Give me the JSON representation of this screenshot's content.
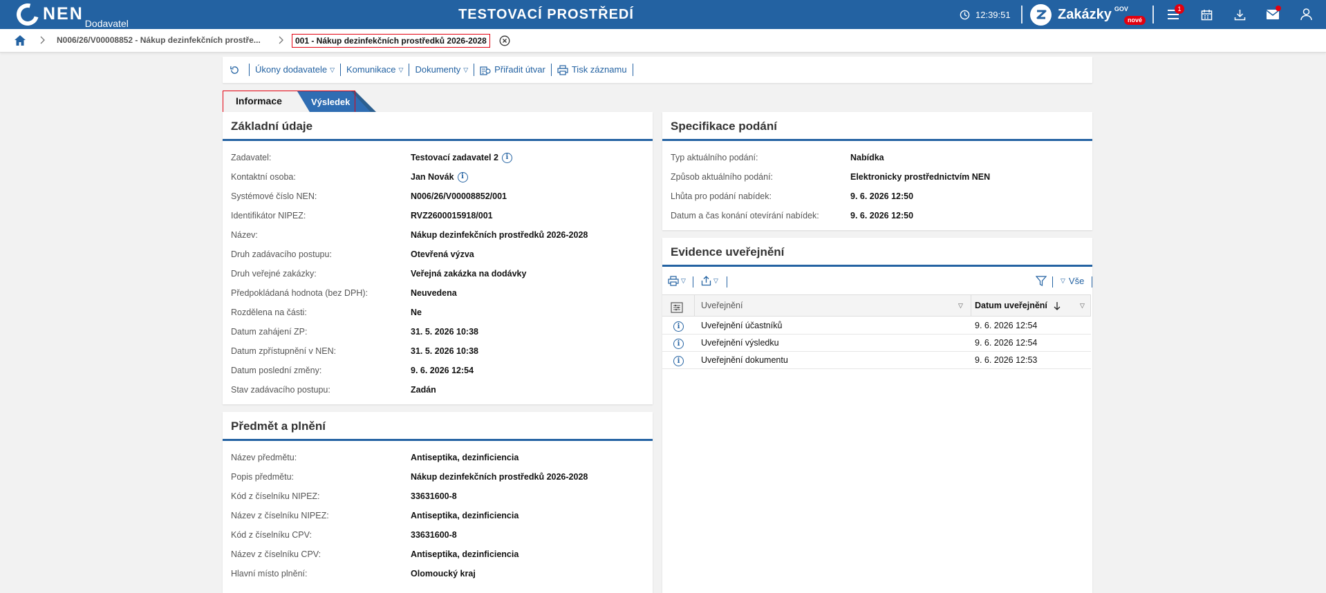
{
  "header": {
    "logo_text": "NEN",
    "logo_sub": "Dodavatel",
    "env_title": "TESTOVACÍ PROSTŘEDÍ",
    "clock": "12:39:51",
    "brand": "Zakázky",
    "brand_gov": "GOV",
    "brand_new": "nové",
    "notif_count": "1"
  },
  "breadcrumb": {
    "item1": "N006/26/V00008852 - Nákup dezinfekčních prostře...",
    "current": "001 - Nákup dezinfekčních prostředků 2026-2028"
  },
  "toolbar": {
    "ukony": "Úkony dodavatele",
    "komunikace": "Komunikace",
    "dokumenty": "Dokumenty",
    "priradit": "Přiřadit útvar",
    "tisk": "Tisk záznamu"
  },
  "tabs": {
    "info": "Informace",
    "vysledek": "Výsledek"
  },
  "zakladni": {
    "title": "Základní údaje",
    "rows": [
      {
        "label": "Zadavatel:",
        "value": "Testovací zadavatel 2"
      },
      {
        "label": "Kontaktní osoba:",
        "value": "Jan Novák"
      },
      {
        "label": "Systémové číslo NEN:",
        "value": "N006/26/V00008852/001"
      },
      {
        "label": "Identifikátor NIPEZ:",
        "value": "RVZ2600015918/001"
      },
      {
        "label": "Název:",
        "value": "Nákup dezinfekčních prostředků 2026-2028"
      },
      {
        "label": "Druh zadávacího postupu:",
        "value": "Otevřená výzva"
      },
      {
        "label": "Druh veřejné zakázky:",
        "value": "Veřejná zakázka na dodávky"
      },
      {
        "label": "Předpokládaná hodnota (bez DPH):",
        "value": "Neuvedena"
      },
      {
        "label": "Rozdělena na části:",
        "value": "Ne"
      },
      {
        "label": "Datum zahájení ZP:",
        "value": "31. 5. 2026 10:38"
      },
      {
        "label": "Datum zpřístupnění v NEN:",
        "value": "31. 5. 2026 10:38"
      },
      {
        "label": "Datum poslední změny:",
        "value": "9. 6. 2026 12:54"
      },
      {
        "label": "Stav zadávacího postupu:",
        "value": "Zadán"
      }
    ]
  },
  "predmet": {
    "title": "Předmět a plnění",
    "rows": [
      {
        "label": "Název předmětu:",
        "value": "Antiseptika, dezinficiencia"
      },
      {
        "label": "Popis předmětu:",
        "value": "Nákup dezinfekčních prostředků 2026-2028"
      },
      {
        "label": "Kód z číselníku NIPEZ:",
        "value": "33631600-8"
      },
      {
        "label": "Název z číselníku NIPEZ:",
        "value": "Antiseptika, dezinficiencia"
      },
      {
        "label": "Kód z číselníku CPV:",
        "value": "33631600-8"
      },
      {
        "label": "Název z číselníku CPV:",
        "value": "Antiseptika, dezinficiencia"
      },
      {
        "label": "Hlavní místo plnění:",
        "value": "Olomoucký kraj"
      }
    ]
  },
  "specifikace": {
    "title": "Specifikace podání",
    "rows": [
      {
        "label": "Typ aktuálního podání:",
        "value": "Nabídka"
      },
      {
        "label": "Způsob aktuálního podání:",
        "value": "Elektronicky prostřednictvím NEN"
      },
      {
        "label": "Lhůta pro podání nabídek:",
        "value": "9. 6. 2026 12:50"
      },
      {
        "label": "Datum a čas konání otevírání nabídek:",
        "value": "9. 6. 2026 12:50"
      }
    ]
  },
  "evidence": {
    "title": "Evidence uveřejnění",
    "filter_all": "Vše",
    "col_name": "Uveřejnění",
    "col_date": "Datum uveřejnění",
    "rows": [
      {
        "name": "Uveřejnění účastníků",
        "date": "9. 6. 2026 12:54"
      },
      {
        "name": "Uveřejnění výsledku",
        "date": "9. 6. 2026 12:54"
      },
      {
        "name": "Uveřejnění dokumentu",
        "date": "9. 6. 2026 12:53"
      }
    ]
  }
}
